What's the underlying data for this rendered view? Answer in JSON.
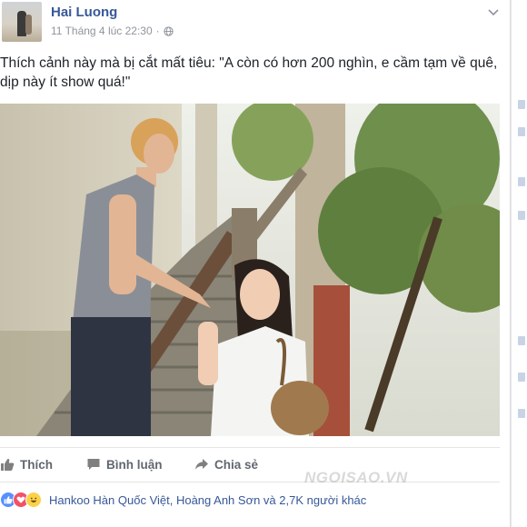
{
  "post": {
    "author": "Hai Luong",
    "timestamp": "11 Tháng 4 lúc 22:30",
    "separator": "·",
    "privacy_icon": "globe-icon",
    "options_icon": "chevron-down-icon",
    "text": "Thích cảnh này mà bị cắt mất tiêu: \"A còn có hơn 200 nghìn, e cầm tạm về quê, dịp này ít show quá!\""
  },
  "actions": {
    "like_label": "Thích",
    "comment_label": "Bình luận",
    "share_label": "Chia sẻ"
  },
  "reactions": {
    "icons": [
      "like-icon",
      "love-icon",
      "haha-icon"
    ],
    "summary": "Hankoo Hàn Quốc Việt, Hoàng Anh Sơn và 2,7K người khác"
  },
  "watermark": "NGOISAO.VN",
  "colors": {
    "link": "#365899",
    "meta": "#90949c",
    "action": "#616770",
    "like": "#5890ff",
    "love": "#f25268",
    "haha": "#fbd14b"
  }
}
